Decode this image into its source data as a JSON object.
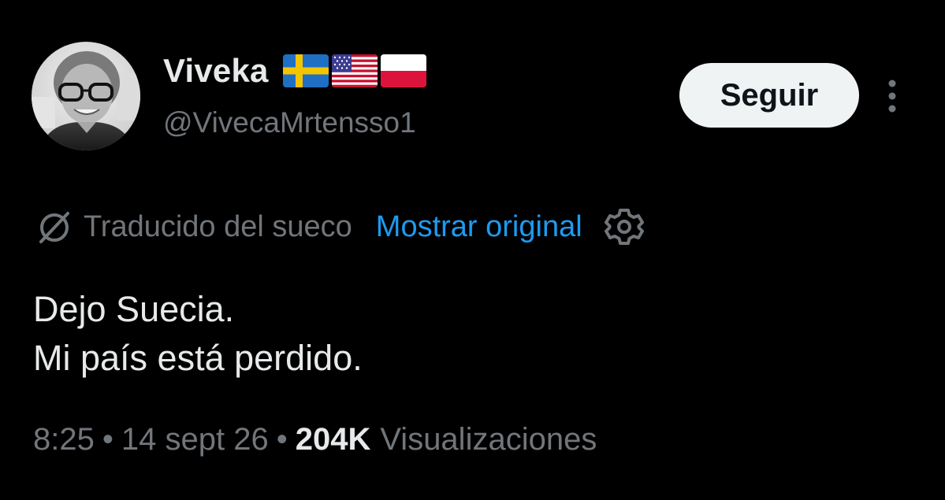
{
  "author": {
    "display_name": "Viveka",
    "flags": [
      "sweden-flag",
      "usa-flag",
      "poland-flag"
    ],
    "handle": "@VivecaMrtensso1",
    "avatar": "profile-photo"
  },
  "actions": {
    "follow_label": "Seguir",
    "more_icon": "more-vertical-icon"
  },
  "translation": {
    "icon": "translate-globe-icon",
    "label": "Traducido del sueco",
    "show_original": "Mostrar original",
    "settings_icon": "gear-icon"
  },
  "tweet": {
    "lines": [
      "Dejo Suecia.",
      "Mi país está perdido."
    ]
  },
  "meta": {
    "time": "8:25",
    "separator": "•",
    "date": "14 sept 26",
    "views_count": "204K",
    "views_label": "Visualizaciones"
  },
  "colors": {
    "background": "#000000",
    "primary_text": "#e7e9ea",
    "secondary_text": "#71767b",
    "link": "#1d9bf0",
    "follow_bg": "#eff3f4"
  }
}
